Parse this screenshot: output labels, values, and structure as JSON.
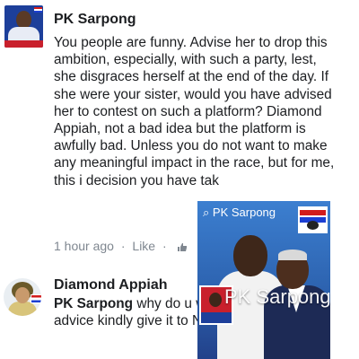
{
  "comments": [
    {
      "author": "PK Sarpong",
      "text": "You people are funny. Advise her to drop this ambition, especially, with such a party, lest, she disgraces herself at the end of the day. If she were your sister, would you have advised her to contest on such a platform? Diamond Appiah, not a bad idea but the platform is awfully bad. Unless you do not want to make any meaningful impact in the race, but for me, this i decision you have tak",
      "time": "1 hour ago",
      "sep": "·",
      "like_label": "Like"
    },
    {
      "author": "Diamond Appiah",
      "reply_to": "PK Sarpong",
      "text": "why do u who don't belong to N advice kindly give it to Nana Akuffo"
    }
  ],
  "overlay": {
    "title": "PK Sarpong",
    "watermark": "PK Sarpong"
  },
  "colors": {
    "text": "#1c1e21",
    "meta": "#7f8790",
    "party_red": "#c9202c",
    "party_blue": "#1d3f9a"
  }
}
